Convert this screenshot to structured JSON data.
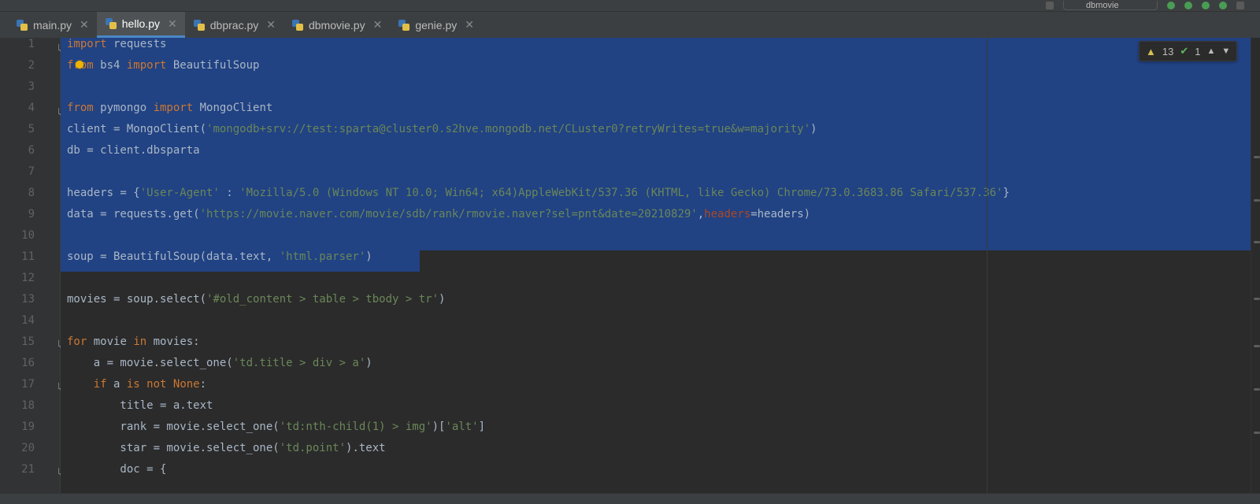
{
  "tabs": [
    {
      "name": "main.py",
      "active": false
    },
    {
      "name": "hello.py",
      "active": true
    },
    {
      "name": "dbprac.py",
      "active": false
    },
    {
      "name": "dbmovie.py",
      "active": false
    },
    {
      "name": "genie.py",
      "active": false
    }
  ],
  "top_config_label": "dbmovie",
  "inspection": {
    "warnings": "13",
    "ok": "1"
  },
  "line_numbers": [
    "1",
    "2",
    "3",
    "4",
    "5",
    "6",
    "7",
    "8",
    "9",
    "10",
    "11",
    "12",
    "13",
    "14",
    "15",
    "16",
    "17",
    "18",
    "19",
    "20",
    "21"
  ],
  "colors": {
    "selection": "#214283",
    "keyword": "#cc7832",
    "string": "#6a8759",
    "background": "#2b2b2b",
    "tab_accent": "#4a88c7"
  }
}
